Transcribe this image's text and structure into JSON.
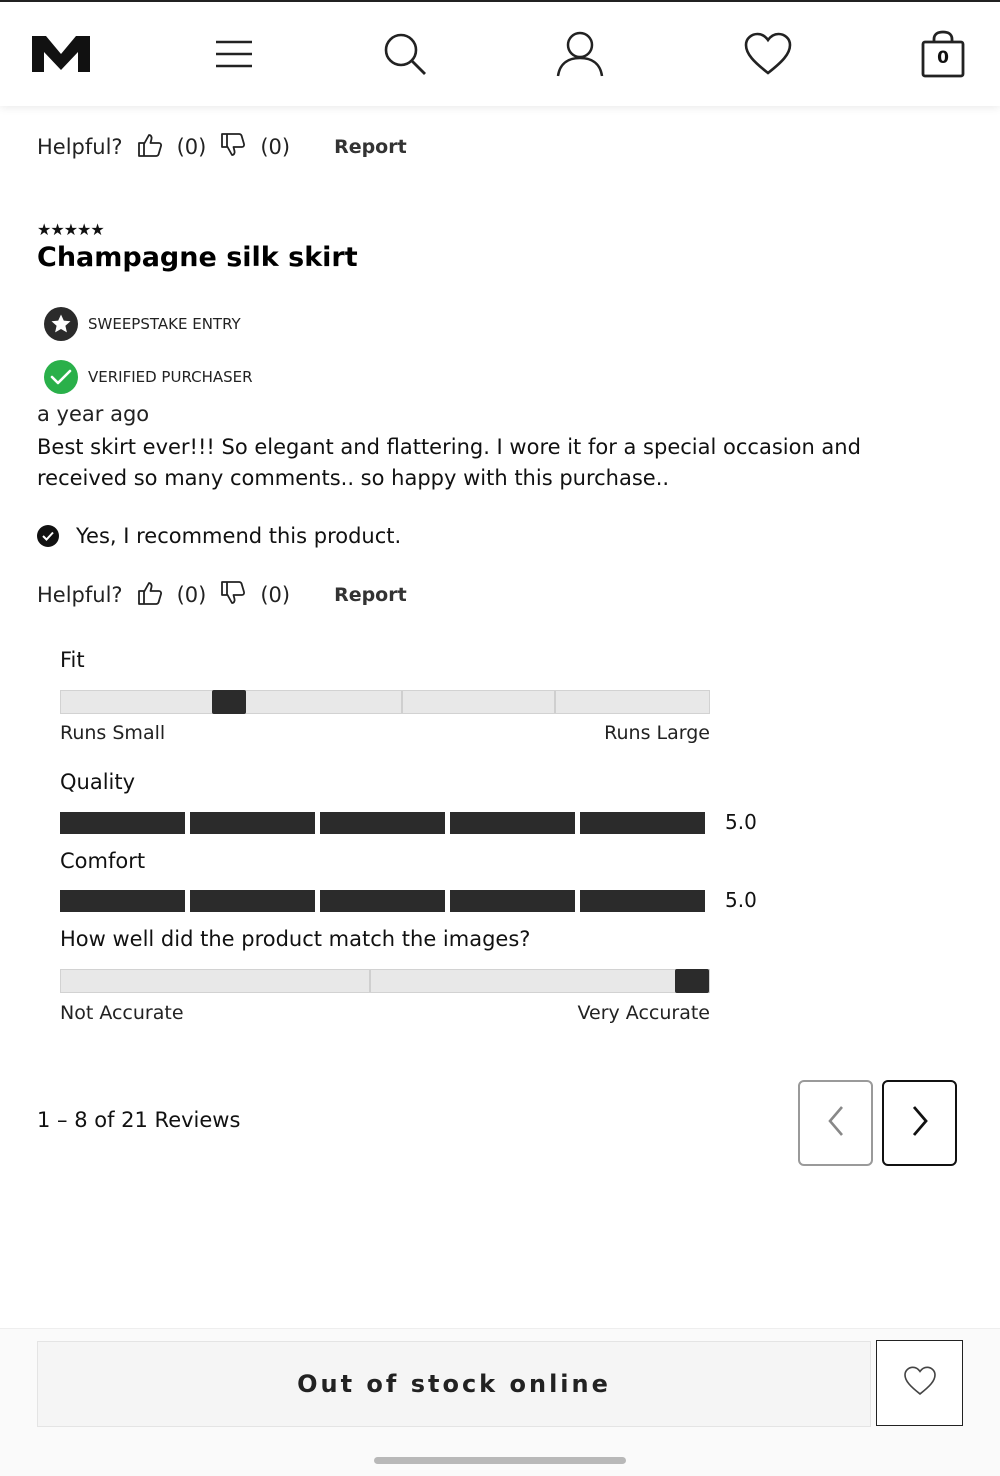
{
  "header": {
    "logo_icon": "m-logo-icon",
    "menu_icon": "hamburger-menu-icon",
    "search_icon": "search-icon",
    "account_icon": "user-icon",
    "wishlist_icon": "heart-icon",
    "bag_icon": "shopping-bag-icon",
    "bag_count": "0"
  },
  "review_prev": {
    "helpful_label": "Helpful?",
    "up_count": "(0)",
    "down_count": "(0)",
    "report_label": "Report"
  },
  "review": {
    "stars": "★★★★★",
    "rating": 5,
    "title": "Champagne silk skirt",
    "badges": [
      {
        "label": "SWEEPSTAKE ENTRY",
        "icon": "star-badge-icon"
      },
      {
        "label": "VERIFIED PURCHASER",
        "icon": "verified-check-icon"
      }
    ],
    "time": "a year ago",
    "body": "Best skirt ever!!! So elegant and flattering. I wore it for a special occasion and received so many comments.. so happy with this purchase..",
    "recommend_text": "Yes, I recommend this product.",
    "helpful_label": "Helpful?",
    "up_count": "(0)",
    "down_count": "(0)",
    "report_label": "Report",
    "fit": {
      "label": "Fit",
      "min_label": "Runs Small",
      "max_label": "Runs Large",
      "value_fraction": 0.26
    },
    "quality": {
      "label": "Quality",
      "score": "5.0",
      "filled_segments": 5
    },
    "comfort": {
      "label": "Comfort",
      "score": "5.0",
      "filled_segments": 5
    },
    "image_match": {
      "label": "How well did the product match the images?",
      "min_label": "Not Accurate",
      "max_label": "Very Accurate",
      "value_fraction": 1.0
    }
  },
  "pagination": {
    "text": "1 – 8 of 21 Reviews",
    "prev_icon": "chevron-left-icon",
    "next_icon": "chevron-right-icon"
  },
  "footer": {
    "stock_button": "Out of stock online",
    "wishlist_icon": "heart-icon"
  },
  "colors": {
    "accent_dark": "#2b2b2b",
    "verified_green": "#2ab04a",
    "track_gray": "#e8e8e8"
  }
}
